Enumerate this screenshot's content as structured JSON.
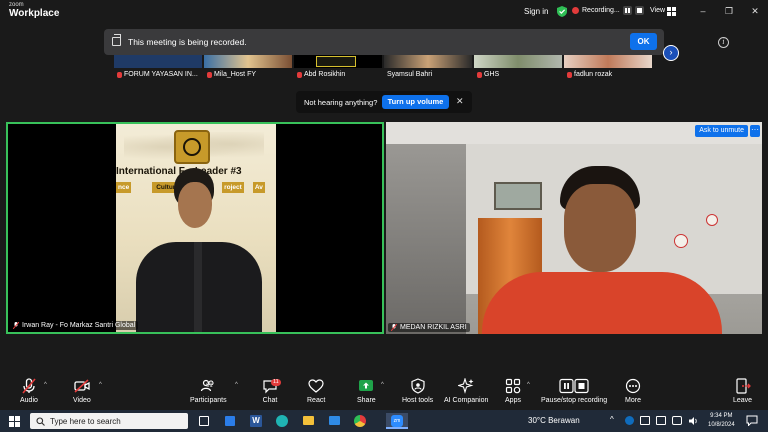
{
  "app": {
    "brand_line1": "zoom",
    "brand_line2": "Workplace"
  },
  "titlebar": {
    "sign_in": "Sign in",
    "recording_label": "Recording...",
    "view_label": "View",
    "minimize": "–",
    "maximize": "❐",
    "close": "✕"
  },
  "notification": {
    "text": "This meeting is being recorded.",
    "info": "i",
    "ok_label": "OK",
    "next": "›"
  },
  "participant_strip": [
    {
      "name": "FORUM YAYASAN IN...",
      "muted": true,
      "color": "#1f3a66"
    },
    {
      "name": "Mila_Host FY",
      "muted": true,
      "color": "#6a5a3e"
    },
    {
      "name": "Abd Rosikhin",
      "muted": false,
      "color": "#3a3a2a"
    },
    {
      "name": "Syamsul Bahri",
      "muted": false,
      "color": "#5b4a3a"
    },
    {
      "name": "GHS",
      "muted": true,
      "color": "#5a6a4a"
    },
    {
      "name": "fadlun rozak",
      "muted": true,
      "color": "#6a4a3a"
    }
  ],
  "audio_prompt": {
    "text": "Not hearing anything?",
    "button": "Turn up volume",
    "close": "✕"
  },
  "tiles": {
    "left": {
      "name": "Irwan Ray - Fo Markaz Santri Global",
      "banner_title": "International F... Leader #3",
      "banner_tags": [
        "nce",
        "Culture E",
        "roject",
        "Av"
      ]
    },
    "right": {
      "name": "MEDAN RIZKIL ASRI",
      "ask_unmute": "Ask to unmute",
      "more": "···"
    }
  },
  "controls": {
    "audio": "Audio",
    "video": "Video",
    "participants": "Participants",
    "participants_count": "61",
    "chat": "Chat",
    "chat_badge": "11",
    "react": "React",
    "share": "Share",
    "host_tools": "Host tools",
    "ai_companion": "AI Companion",
    "apps": "Apps",
    "pause_recording": "Pause/stop recording",
    "more": "More",
    "leave": "Leave"
  },
  "taskbar": {
    "search_placeholder": "Type here to search",
    "weather": "30°C  Berawan",
    "time": "9:34 PM",
    "date": "10/8/2024"
  },
  "colors": {
    "accent": "#0e71eb",
    "active_speaker": "#38c15a",
    "alert": "#e23b3b",
    "share_green": "#1fa34a"
  }
}
